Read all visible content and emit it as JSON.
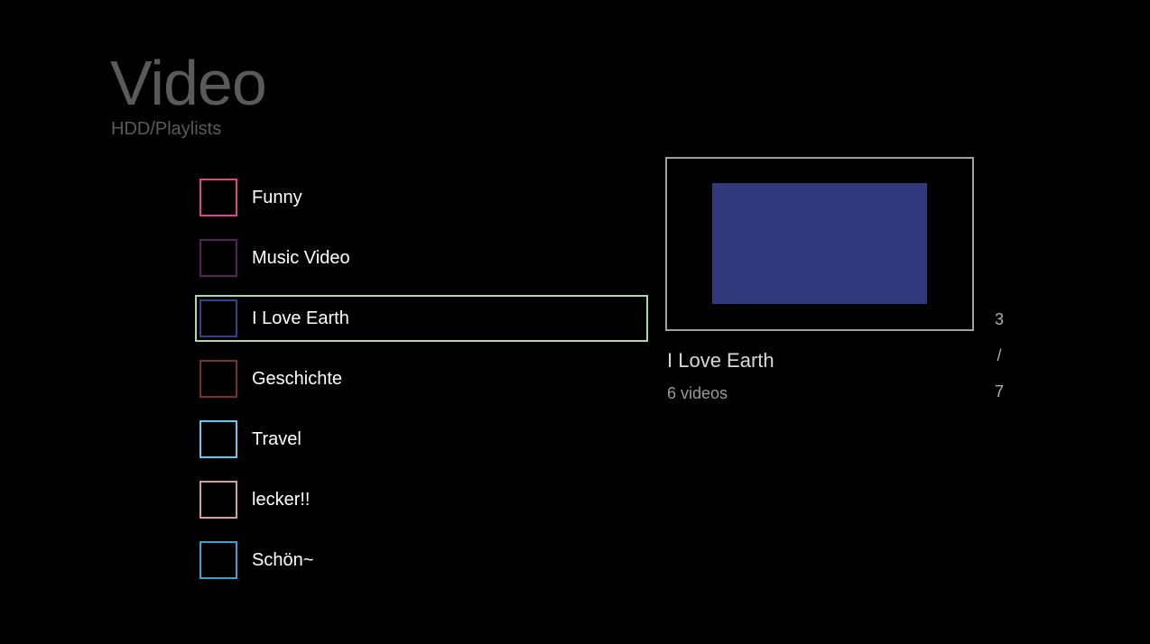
{
  "header": {
    "title": "Video",
    "breadcrumb": "HDD/Playlists"
  },
  "playlists": [
    {
      "label": "Funny",
      "color": "#e0438c"
    },
    {
      "label": "Music Video",
      "color": "#5b1f5e"
    },
    {
      "label": "I Love Earth",
      "color": "#3a3f8f"
    },
    {
      "label": "Geschichte",
      "color": "#7a2e2e"
    },
    {
      "label": "Travel",
      "color": "#66c8ef"
    },
    {
      "label": "lecker!!",
      "color": "#d99aa8"
    },
    {
      "label": "Schön~",
      "color": "#2aa8dc"
    }
  ],
  "selected_index": 2,
  "preview": {
    "title": "I Love Earth",
    "count": "6 videos",
    "thumbnail_color": "#33397d"
  },
  "pager": {
    "current": "3",
    "separator": "/",
    "total": "7"
  }
}
